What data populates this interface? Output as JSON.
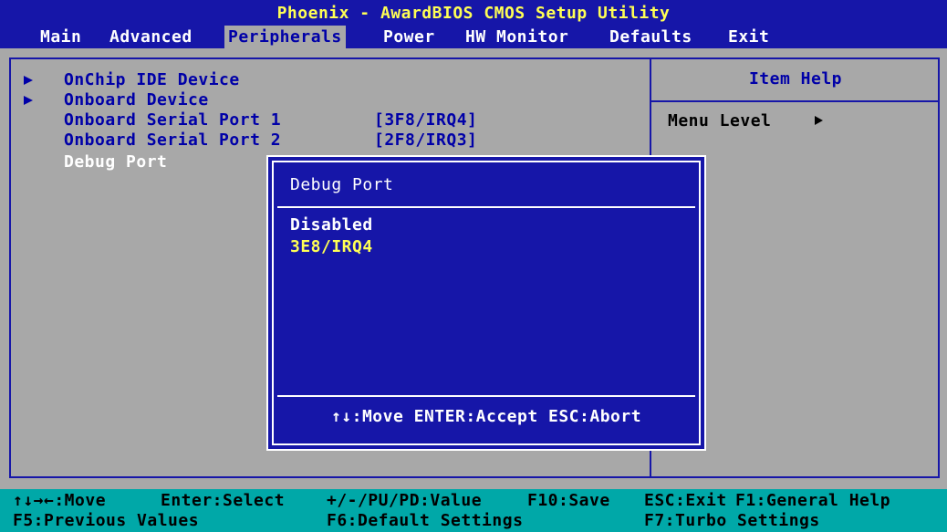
{
  "title": "Phoenix - AwardBIOS CMOS Setup Utility",
  "menu": [
    {
      "label": "Main",
      "active": false
    },
    {
      "label": "Advanced",
      "active": false
    },
    {
      "label": "Peripherals",
      "active": true
    },
    {
      "label": "Power",
      "active": false
    },
    {
      "label": "HW Monitor",
      "active": false
    },
    {
      "label": "Defaults",
      "active": false
    },
    {
      "label": "Exit",
      "active": false
    }
  ],
  "items": [
    {
      "label": "OnChip IDE Device",
      "submenu": true,
      "value": ""
    },
    {
      "label": "Onboard Device",
      "submenu": true,
      "value": ""
    },
    {
      "label": "Onboard Serial Port 1",
      "submenu": false,
      "value": "[3F8/IRQ4]"
    },
    {
      "label": "Onboard Serial Port 2",
      "submenu": false,
      "value": "[2F8/IRQ3]"
    },
    {
      "label": "Debug Port",
      "submenu": false,
      "value": "",
      "selected": true
    }
  ],
  "help": {
    "title": "Item Help",
    "menu_level_label": "Menu Level",
    "menu_level_icon": "triangle-right-icon"
  },
  "popup": {
    "title": "Debug Port",
    "options": [
      {
        "label": "Disabled",
        "selected": false
      },
      {
        "label": "3E8/IRQ4",
        "selected": true
      }
    ],
    "hint": "↑↓:Move ENTER:Accept ESC:Abort"
  },
  "footer": {
    "row1": [
      "↑↓→←:Move",
      "Enter:Select",
      "+/-/PU/PD:Value",
      "F10:Save",
      "ESC:Exit",
      "F1:General Help"
    ],
    "row2": [
      "F5:Previous Values",
      "F6:Default Settings",
      "F7:Turbo Settings"
    ]
  },
  "colors": {
    "background": "#a8a8a8",
    "bar": "#1616a8",
    "title_text": "#ffff54",
    "footer": "#00a8a8",
    "selected_option": "#ffff54"
  }
}
